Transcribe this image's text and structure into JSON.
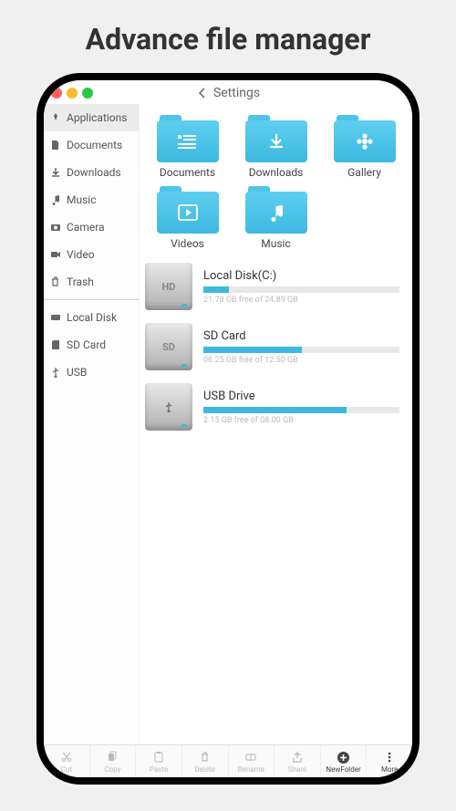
{
  "page_title": "Advance file manager",
  "header": {
    "title": "Settings"
  },
  "sidebar": {
    "top": [
      {
        "id": "applications",
        "label": "Applications",
        "icon": "rocket",
        "active": true
      },
      {
        "id": "documents",
        "label": "Documents",
        "icon": "doc"
      },
      {
        "id": "downloads",
        "label": "Downloads",
        "icon": "download"
      },
      {
        "id": "music",
        "label": "Music",
        "icon": "music"
      },
      {
        "id": "camera",
        "label": "Camera",
        "icon": "camera"
      },
      {
        "id": "video",
        "label": "Video",
        "icon": "video"
      },
      {
        "id": "trash",
        "label": "Trash",
        "icon": "trash"
      }
    ],
    "bottom": [
      {
        "id": "localdisk",
        "label": "Local Disk",
        "icon": "disk"
      },
      {
        "id": "sdcard",
        "label": "SD Card",
        "icon": "sd"
      },
      {
        "id": "usb",
        "label": "USB",
        "icon": "usb"
      }
    ]
  },
  "folders": [
    {
      "id": "documents",
      "label": "Documents",
      "inner": "list"
    },
    {
      "id": "downloads",
      "label": "Downloads",
      "inner": "download"
    },
    {
      "id": "gallery",
      "label": "Gallery",
      "inner": "flower"
    },
    {
      "id": "videos",
      "label": "Videos",
      "inner": "play"
    },
    {
      "id": "music",
      "label": "Music",
      "inner": "music"
    }
  ],
  "drives": [
    {
      "id": "c",
      "badge": "HD",
      "name": "Local Disk(C:)",
      "used_pct": 13,
      "free_text": "21.78 GB free of 24.89 GB"
    },
    {
      "id": "sd",
      "badge": "SD",
      "name": "SD Card",
      "used_pct": 50,
      "free_text": "06.25 GB free of 12.50 GB"
    },
    {
      "id": "usb",
      "badge": "usb-glyph",
      "name": "USB Drive",
      "used_pct": 73,
      "free_text": "2.15 GB free of 08.00 GB"
    }
  ],
  "toolbar": [
    {
      "id": "cut",
      "label": "Cut",
      "icon": "scissors"
    },
    {
      "id": "copy",
      "label": "Copy",
      "icon": "copy"
    },
    {
      "id": "paste",
      "label": "Paste",
      "icon": "clipboard"
    },
    {
      "id": "delete",
      "label": "Delete",
      "icon": "trash"
    },
    {
      "id": "rename",
      "label": "Rename",
      "icon": "rename"
    },
    {
      "id": "share",
      "label": "Share",
      "icon": "share"
    },
    {
      "id": "newfolder",
      "label": "NewFolder",
      "icon": "plus",
      "dark": true
    },
    {
      "id": "more",
      "label": "More",
      "icon": "dots",
      "dark": true
    }
  ]
}
